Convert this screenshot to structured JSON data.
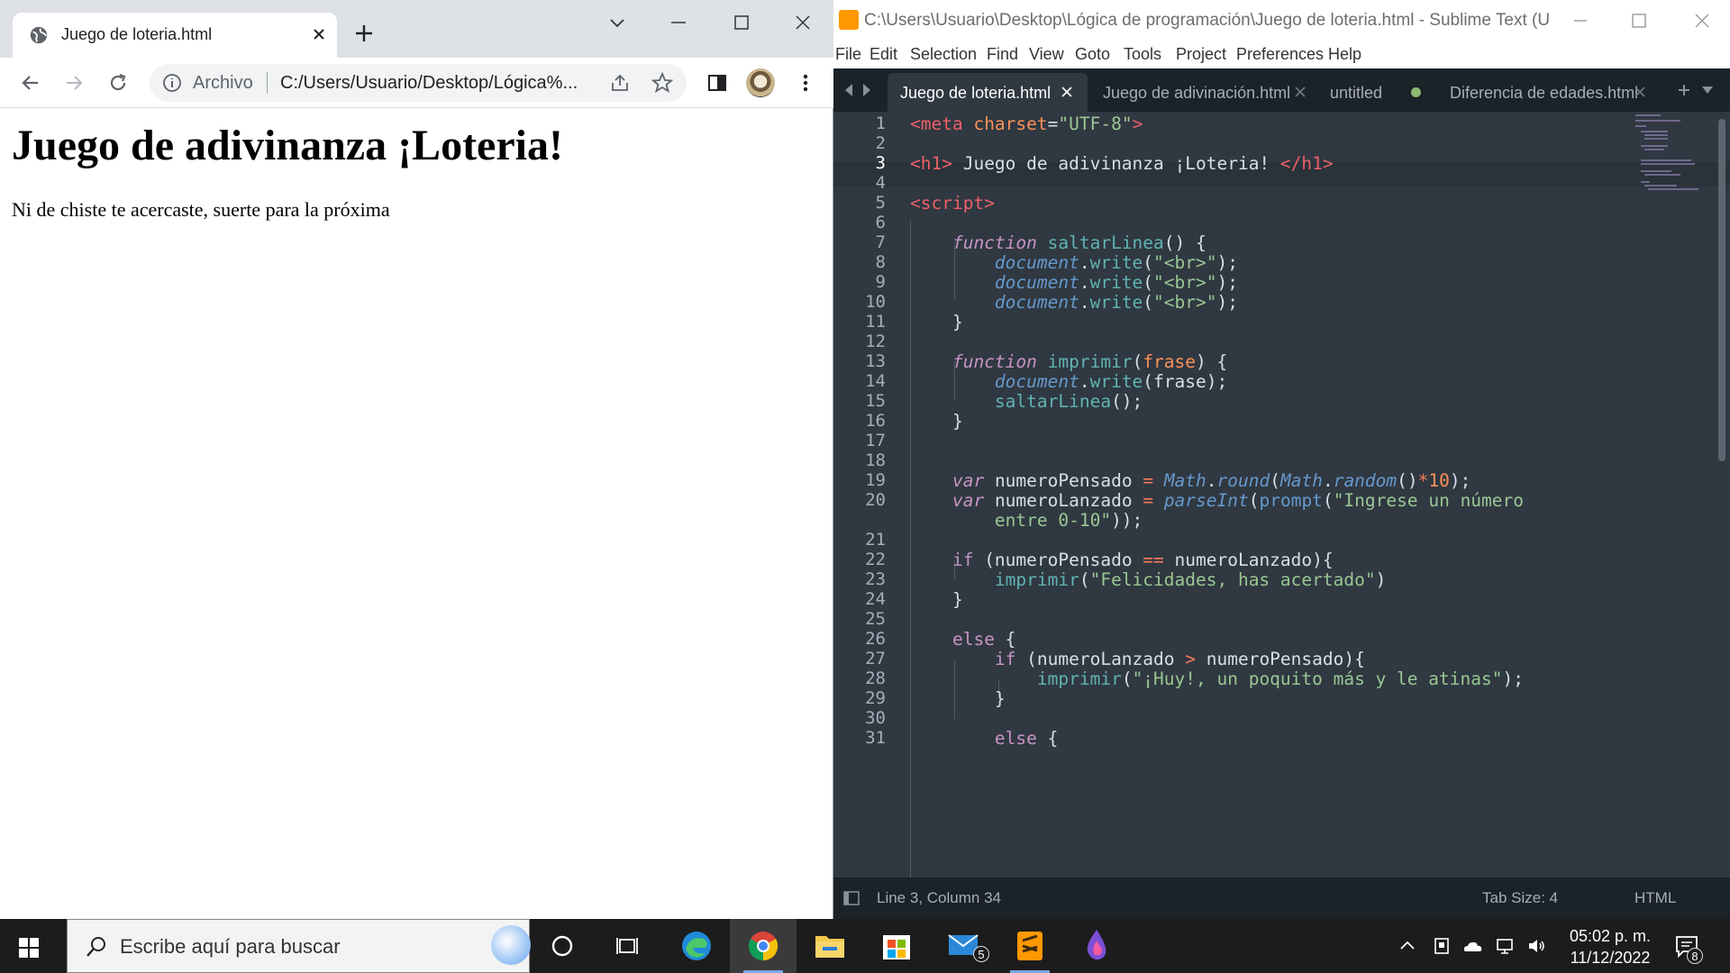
{
  "browser": {
    "tab_title": "Juego de loteria.html",
    "scheme_label": "Archivo",
    "url": "C:/Users/Usuario/Desktop/Lógica%...",
    "page_heading": "Juego de adivinanza ¡Loteria!",
    "page_text": "Ni de chiste te acercaste, suerte para la próxima"
  },
  "editor": {
    "window_title": "C:\\Users\\Usuario\\Desktop\\Lógica de programación\\Juego de loteria.html - Sublime Text (UNR...",
    "menu": [
      "File",
      "Edit",
      "Selection",
      "Find",
      "View",
      "Goto",
      "Tools",
      "Project",
      "Preferences",
      "Help"
    ],
    "tabs": [
      {
        "label": "Juego de loteria.html",
        "active": true,
        "state": "close"
      },
      {
        "label": "Juego de adivinación.html",
        "active": false,
        "state": "close"
      },
      {
        "label": "untitled",
        "active": false,
        "state": "dirty"
      },
      {
        "label": "Diferencia de edades.html",
        "active": false,
        "state": "close"
      }
    ],
    "line_numbers": [
      "1",
      "2",
      "3",
      "4",
      "5",
      "6",
      "7",
      "8",
      "9",
      "10",
      "11",
      "12",
      "13",
      "14",
      "15",
      "16",
      "17",
      "18",
      "19",
      "20",
      "",
      "21",
      "22",
      "23",
      "24",
      "25",
      "26",
      "27",
      "28",
      "29",
      "30",
      "31"
    ],
    "current_line": "3",
    "status": {
      "position": "Line 3, Column 34",
      "tab_size": "Tab Size: 4",
      "syntax": "HTML"
    }
  },
  "taskbar": {
    "search_placeholder": "Escribe aquí para buscar",
    "time": "05:02 p. m.",
    "date": "11/12/2022",
    "mail_badge": "5",
    "notification_badge": "8"
  },
  "colors": {
    "editor_bg": "#303841",
    "tag": "#ec5f67",
    "string": "#99c794",
    "keyword": "#c594c5",
    "function": "#5fb3b3"
  }
}
